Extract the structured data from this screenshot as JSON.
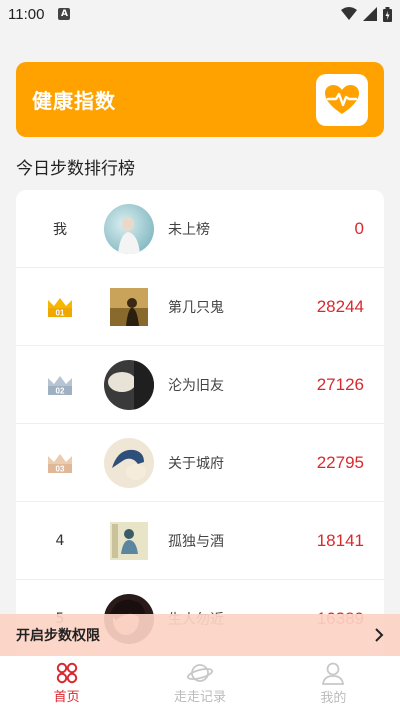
{
  "status_bar": {
    "time": "11:00",
    "notif_icon": "a-icon"
  },
  "health_card": {
    "title": "健康指数",
    "icon": "heart-pulse-icon",
    "accent": "#ffa200"
  },
  "ranking": {
    "section_title": "今日步数排行榜",
    "rows": [
      {
        "rank": "我",
        "name": "未上榜",
        "steps": "0"
      },
      {
        "rank": "01",
        "name": "第几只鬼",
        "steps": "28244"
      },
      {
        "rank": "02",
        "name": "沦为旧友",
        "steps": "27126"
      },
      {
        "rank": "03",
        "name": "关于城府",
        "steps": "22795"
      },
      {
        "rank": "4",
        "name": "孤独与酒",
        "steps": "18141"
      },
      {
        "rank": "5",
        "name": "生人勿近",
        "steps": "16389"
      }
    ]
  },
  "permission_bar": {
    "label": "开启步数权限",
    "icon": "chevron-right-icon"
  },
  "tabbar": {
    "tabs": [
      {
        "label": "首页",
        "icon": "grid-icon",
        "active": true
      },
      {
        "label": "走走记录",
        "icon": "planet-icon",
        "active": false
      },
      {
        "label": "我的",
        "icon": "user-icon",
        "active": false
      }
    ]
  },
  "colors": {
    "accent_red": "#d8292f",
    "gold": "#f5b800",
    "silver": "#9fb0c2",
    "bronze": "#e0b897"
  }
}
